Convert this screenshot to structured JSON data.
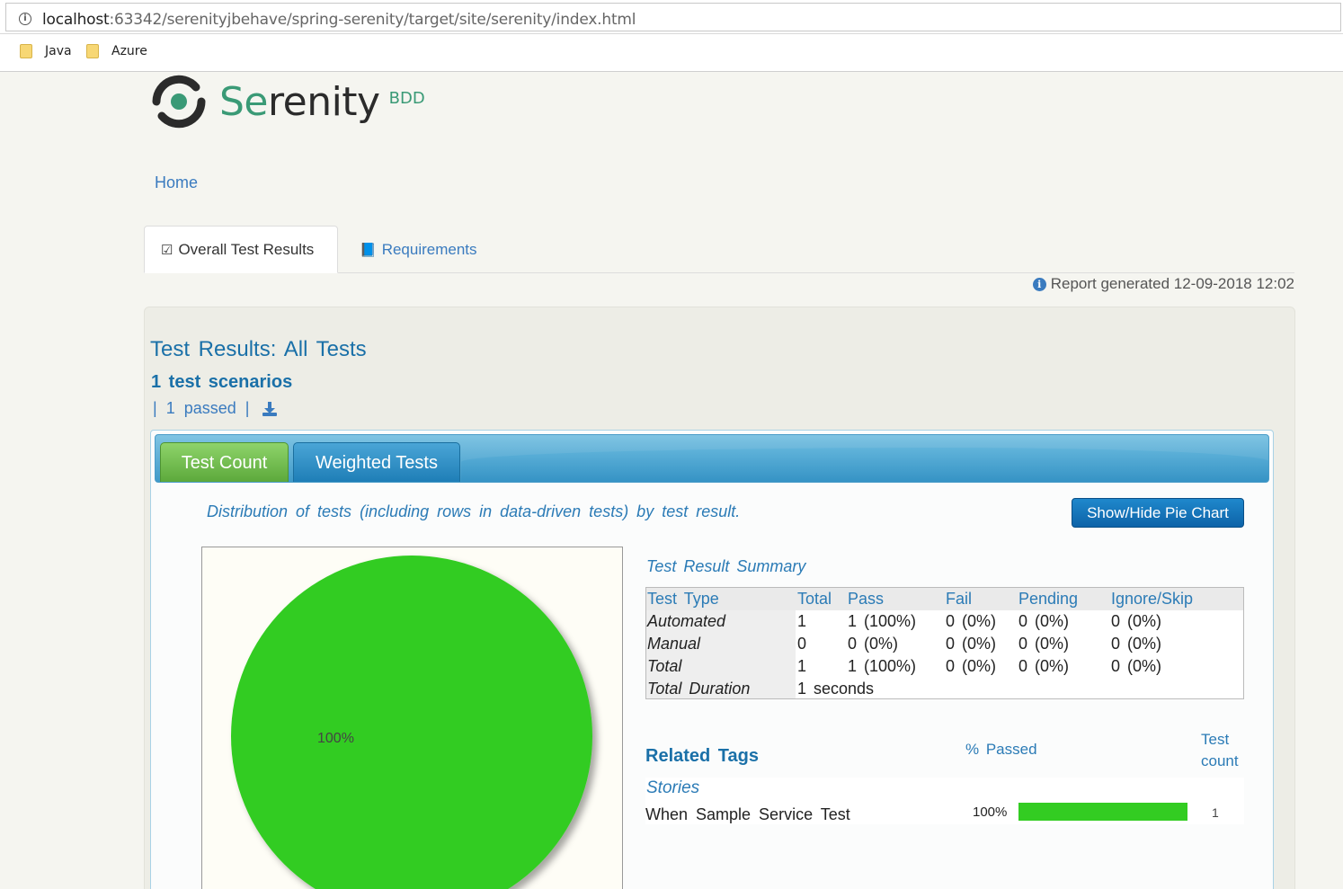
{
  "browser": {
    "url_host": "localhost",
    "url_rest": ":63342/serenityjbehave/spring-serenity/target/site/serenity/index.html",
    "bookmarks": [
      "Java",
      "Azure"
    ]
  },
  "logo": {
    "word_se": "Se",
    "word_rest": "renity",
    "suffix": "BDD"
  },
  "nav": {
    "home": "Home"
  },
  "tabs": {
    "overall": "Overall Test Results",
    "requirements": "Requirements"
  },
  "report_generated": "Report generated 12-09-2018 12:02",
  "results": {
    "title": "Test Results: All Tests",
    "scenarios": "1 test scenarios",
    "passed_sep1": "|",
    "passed": "1 passed",
    "passed_sep2": "|"
  },
  "subtabs": {
    "count": "Test Count",
    "weighted": "Weighted Tests"
  },
  "distribution": "Distribution of tests (including rows in data-driven tests) by test result.",
  "pie_button": "Show/Hide Pie Chart",
  "chart_data": {
    "type": "pie",
    "slices": [
      {
        "label": "100%",
        "value": 100,
        "color": "#33cc22"
      }
    ]
  },
  "summary": {
    "title": "Test Result Summary",
    "headers": [
      "Test Type",
      "Total",
      "Pass",
      "Fail",
      "Pending",
      "Ignore/Skip"
    ],
    "rows": [
      [
        "Automated",
        "1",
        "1 (100%)",
        "0 (0%)",
        "0 (0%)",
        "0 (0%)"
      ],
      [
        "Manual",
        "0",
        "0 (0%)",
        "0 (0%)",
        "0 (0%)",
        "0 (0%)"
      ],
      [
        "Total",
        "1",
        "1 (100%)",
        "0 (0%)",
        "0 (0%)",
        "0 (0%)"
      ]
    ],
    "duration_label": "Total Duration",
    "duration_value": "1 seconds"
  },
  "related": {
    "title": "Related Tags",
    "pct_header": "% Passed",
    "count_header_1": "Test",
    "count_header_2": "count",
    "group": "Stories",
    "story": "When Sample Service Test",
    "story_pct": "100%",
    "story_pct_value": 100,
    "story_count": "1"
  },
  "colors": {
    "accent": "#1a70a8",
    "pass": "#33cc22"
  }
}
